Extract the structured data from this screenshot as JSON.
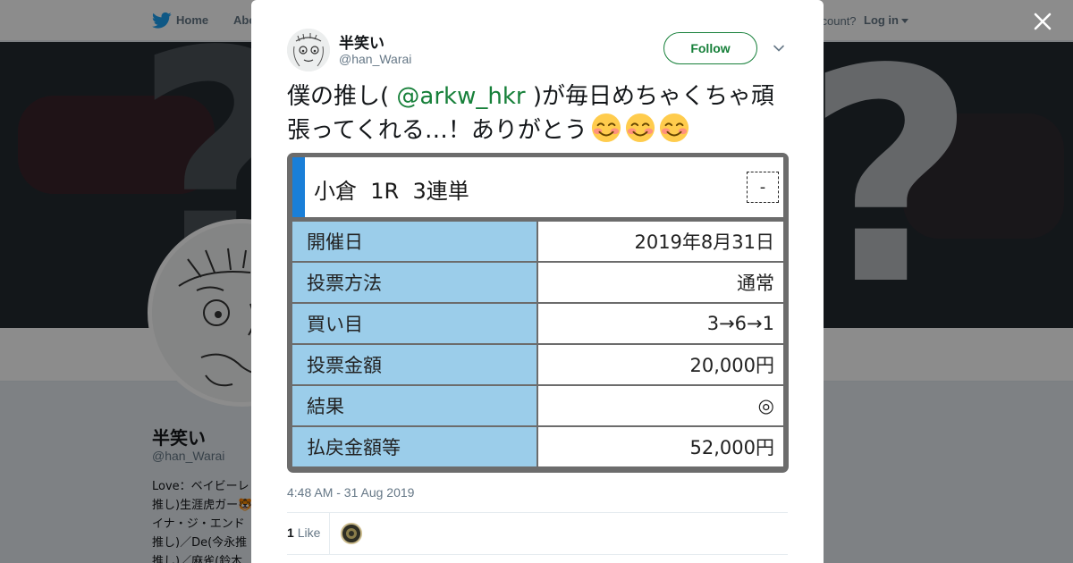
{
  "topnav": {
    "home_label": "Home",
    "about_label": "Abo",
    "account_text": "ccount?",
    "login_label": "Log in"
  },
  "profile": {
    "name": "半笑い",
    "handle": "@han_Warai",
    "bio_lines": [
      "Love：ベイビーレ",
      "推し)生涯虎ガー🐯",
      "イナ・ジ・エンド",
      "推し)／De(今永推",
      "推し)／麻雀(鈴木"
    ]
  },
  "tweet": {
    "author_name": "半笑い",
    "author_handle": "@han_Warai",
    "follow_label": "Follow",
    "text_before_mention": "僕の推し( ",
    "mention": "@arkw_hkr",
    "text_after_mention": " )が毎日めちゃくちゃ頑張ってくれる…！ありがとう",
    "emoji": "smiling-face-icon",
    "timestamp": "4:48 AM - 31 Aug 2019",
    "like_count": "1",
    "like_label": "Like"
  },
  "bet_card": {
    "title": "小倉  1R  3連単",
    "mark": "-",
    "rows": [
      {
        "label": "開催日",
        "value": "2019年8月31日"
      },
      {
        "label": "投票方法",
        "value": "通常"
      },
      {
        "label": "買い目",
        "value": "3→6→1"
      },
      {
        "label": "投票金額",
        "value": "20,000円"
      },
      {
        "label": "結果",
        "value": "◎"
      },
      {
        "label": "払戻金額等",
        "value": "52,000円"
      }
    ]
  },
  "colors": {
    "brand_green": "#17803a",
    "card_accent": "#1a7fd8",
    "card_label_bg": "#9bcdea",
    "twitter_blue": "#1da1f2"
  }
}
